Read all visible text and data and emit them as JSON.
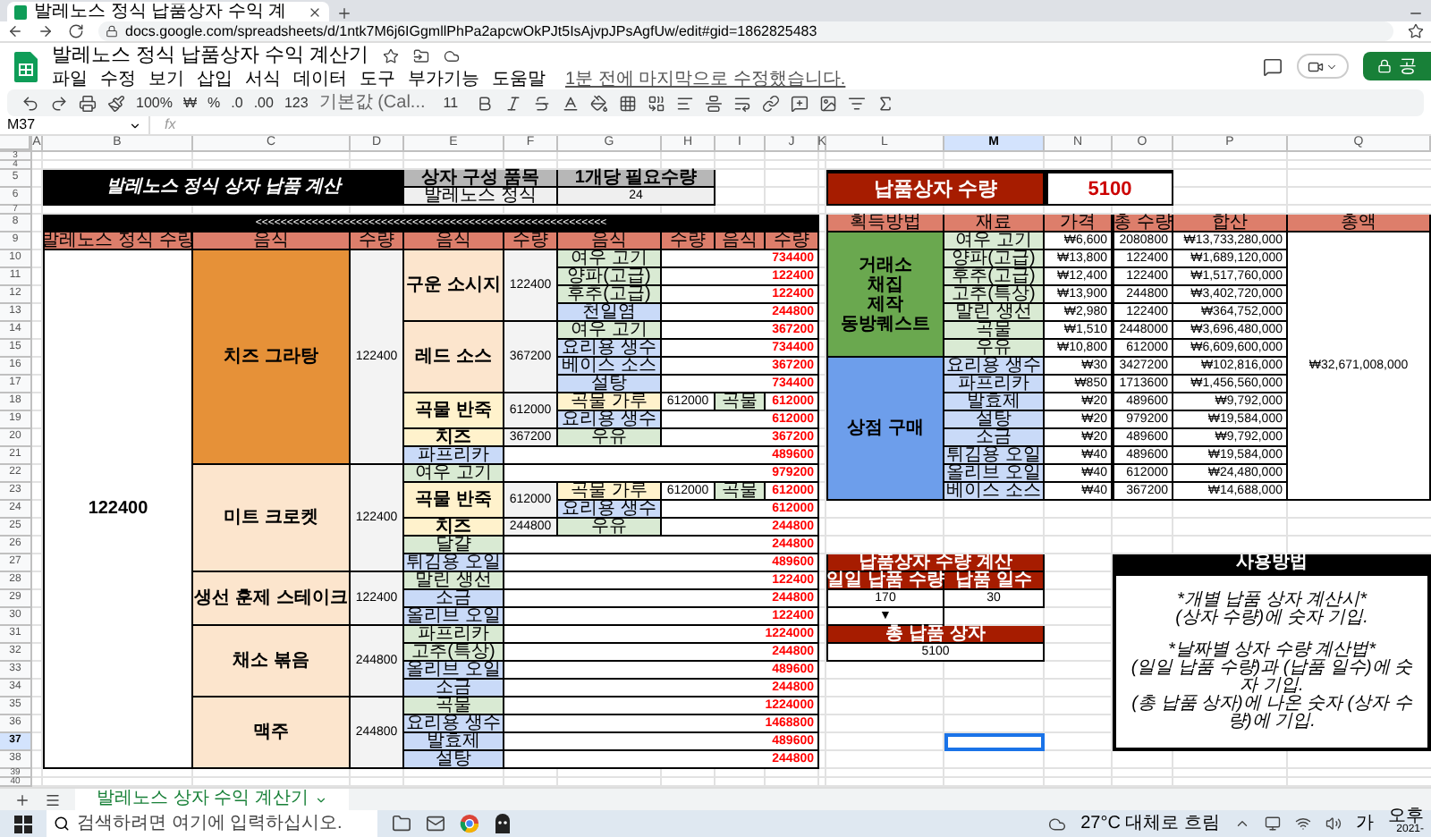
{
  "browser": {
    "tab_title": "발레노스 정식 납품상자 수익 계",
    "url": "docs.google.com/spreadsheets/d/1ntk7M6j6IGgmllPhPa2apcwOkPJt5IsAjvpJPsAgfUw/edit#gid=1862825483"
  },
  "doc": {
    "title": "발레노스 정식 납품상자 수익 계산기",
    "menu": [
      "파일",
      "수정",
      "보기",
      "삽입",
      "서식",
      "데이터",
      "도구",
      "부가기능",
      "도움말"
    ],
    "last_edit": "1분 전에 마지막으로 수정했습니다.",
    "share_label": "공"
  },
  "toolbar": {
    "zoom": "100%",
    "currency": "₩",
    "percent": "%",
    "decrease_decimal": ".0",
    "increase_decimal": ".00",
    "number_format": "123",
    "font": "기본값 (Cal...",
    "font_size": "11"
  },
  "formula_bar": {
    "name_box": "M37",
    "fx": "fx"
  },
  "columns": [
    {
      "label": "A",
      "selected": false
    },
    {
      "label": "B",
      "selected": false
    },
    {
      "label": "C",
      "selected": false
    },
    {
      "label": "D",
      "selected": false
    },
    {
      "label": "E",
      "selected": false
    },
    {
      "label": "F",
      "selected": false
    },
    {
      "label": "G",
      "selected": false
    },
    {
      "label": "H",
      "selected": false
    },
    {
      "label": "I",
      "selected": false
    },
    {
      "label": "J",
      "selected": false
    },
    {
      "label": "K",
      "selected": false
    },
    {
      "label": "L",
      "selected": false
    },
    {
      "label": "M",
      "selected": true
    },
    {
      "label": "N",
      "selected": false
    },
    {
      "label": "O",
      "selected": false
    },
    {
      "label": "P",
      "selected": false
    },
    {
      "label": "Q",
      "selected": false
    }
  ],
  "rows": [
    {
      "label": "3",
      "selected": false
    },
    {
      "label": "4",
      "selected": false
    },
    {
      "label": "5",
      "selected": false
    },
    {
      "label": "6",
      "selected": false
    },
    {
      "label": "7",
      "selected": false
    },
    {
      "label": "8",
      "selected": false
    },
    {
      "label": "9",
      "selected": false
    },
    {
      "label": "10",
      "selected": false
    },
    {
      "label": "11",
      "selected": false
    },
    {
      "label": "12",
      "selected": false
    },
    {
      "label": "13",
      "selected": false
    },
    {
      "label": "14",
      "selected": false
    },
    {
      "label": "15",
      "selected": false
    },
    {
      "label": "16",
      "selected": false
    },
    {
      "label": "17",
      "selected": false
    },
    {
      "label": "18",
      "selected": false
    },
    {
      "label": "19",
      "selected": false
    },
    {
      "label": "20",
      "selected": false
    },
    {
      "label": "21",
      "selected": false
    },
    {
      "label": "22",
      "selected": false
    },
    {
      "label": "23",
      "selected": false
    },
    {
      "label": "24",
      "selected": false
    },
    {
      "label": "25",
      "selected": false
    },
    {
      "label": "26",
      "selected": false
    },
    {
      "label": "27",
      "selected": false
    },
    {
      "label": "28",
      "selected": false
    },
    {
      "label": "29",
      "selected": false
    },
    {
      "label": "30",
      "selected": false
    },
    {
      "label": "31",
      "selected": false
    },
    {
      "label": "32",
      "selected": false
    },
    {
      "label": "33",
      "selected": false
    },
    {
      "label": "34",
      "selected": false
    },
    {
      "label": "35",
      "selected": false
    },
    {
      "label": "36",
      "selected": false
    },
    {
      "label": "37",
      "selected": true
    },
    {
      "label": "38",
      "selected": false
    },
    {
      "label": "39",
      "selected": false
    },
    {
      "label": "40",
      "selected": false
    }
  ],
  "summary": {
    "title": "발레노스 정식 상자 납품 계산",
    "component_header": "상자 구성 품목",
    "component": "발레노스 정식",
    "per_box_header": "1개당 필요수량",
    "per_box": "24"
  },
  "box_count": {
    "label": "납품상자 수량",
    "value": "5100"
  },
  "breakdown": {
    "banner": "<<<<<<<<<<<<<<<<<<<<<<<<<<<<<<<<<<<<<<<<<<<<<<<<<<<<<<<<",
    "headers": [
      "발레노스 정식 수량",
      "음식",
      "수량",
      "음식",
      "수량",
      "음식",
      "수량",
      "음식",
      "수량"
    ],
    "total": "122400",
    "dishes": [
      {
        "name": "치즈 그라탕",
        "qty": "122400",
        "color": "#e69138",
        "components": [
          {
            "kind": "recipe",
            "name": "구운 소시지",
            "color": "#fce5cd",
            "qty": "122400",
            "parts": [
              {
                "kind": "material",
                "name": "여우 고기",
                "color": "#d9ead3",
                "total": "734400"
              },
              {
                "kind": "material",
                "name": "양파(고급)",
                "color": "#d9ead3",
                "total": "122400"
              },
              {
                "kind": "material",
                "name": "후추(고급)",
                "color": "#d9ead3",
                "total": "122400"
              },
              {
                "kind": "material",
                "name": "천일염",
                "color": "#c9daf8",
                "total": "244800"
              }
            ]
          },
          {
            "kind": "recipe",
            "name": "레드 소스",
            "color": "#fce5cd",
            "qty": "367200",
            "parts": [
              {
                "kind": "material",
                "name": "여우 고기",
                "color": "#d9ead3",
                "total": "367200"
              },
              {
                "kind": "material",
                "name": "요리용 생수",
                "color": "#c9daf8",
                "total": "734400"
              },
              {
                "kind": "material",
                "name": "베이스 소스",
                "color": "#c9daf8",
                "total": "367200"
              },
              {
                "kind": "material",
                "name": "설탕",
                "color": "#c9daf8",
                "total": "734400"
              }
            ]
          },
          {
            "kind": "recipe",
            "name": "곡물 반죽",
            "color": "#fff2cc",
            "qty": "612000",
            "parts": [
              {
                "kind": "recipe",
                "name": "곡물 가루",
                "color": "#fff2cc",
                "qty": "612000",
                "sub": {
                  "name": "곡물",
                  "color": "#d9ead3"
                },
                "total": "612000"
              },
              {
                "kind": "material",
                "name": "요리용 생수",
                "color": "#c9daf8",
                "total": "612000"
              }
            ]
          },
          {
            "kind": "recipe",
            "name": "치즈",
            "color": "#fff2cc",
            "qty": "367200",
            "parts": [
              {
                "kind": "material",
                "name": "우유",
                "color": "#d9ead3",
                "total": "367200"
              }
            ]
          },
          {
            "kind": "material",
            "name": "파프리카",
            "color": "#c9daf8",
            "total": "489600"
          }
        ]
      },
      {
        "name": "미트 크로켓",
        "qty": "122400",
        "color": "#fce5cd",
        "components": [
          {
            "kind": "material",
            "name": "여우 고기",
            "color": "#d9ead3",
            "total": "979200"
          },
          {
            "kind": "recipe",
            "name": "곡물 반죽",
            "color": "#fff2cc",
            "qty": "612000",
            "parts": [
              {
                "kind": "recipe",
                "name": "곡물 가루",
                "color": "#fff2cc",
                "qty": "612000",
                "sub": {
                  "name": "곡물",
                  "color": "#d9ead3"
                },
                "total": "612000"
              },
              {
                "kind": "material",
                "name": "요리용 생수",
                "color": "#c9daf8",
                "total": "612000"
              }
            ]
          },
          {
            "kind": "recipe",
            "name": "치즈",
            "color": "#fff2cc",
            "qty": "244800",
            "parts": [
              {
                "kind": "material",
                "name": "우유",
                "color": "#d9ead3",
                "total": "244800"
              }
            ]
          },
          {
            "kind": "material",
            "name": "달걀",
            "color": "#d9ead3",
            "total": "244800"
          },
          {
            "kind": "material",
            "name": "튀김용 오일",
            "color": "#c9daf8",
            "total": "489600"
          }
        ]
      },
      {
        "name": "생선 훈제 스테이크",
        "qty": "122400",
        "color": "#fce5cd",
        "components": [
          {
            "kind": "material",
            "name": "말린 생선",
            "color": "#d9ead3",
            "total": "122400"
          },
          {
            "kind": "material",
            "name": "소금",
            "color": "#c9daf8",
            "total": "244800"
          },
          {
            "kind": "material",
            "name": "올리브 오일",
            "color": "#c9daf8",
            "total": "122400"
          }
        ]
      },
      {
        "name": "채소 볶음",
        "qty": "244800",
        "color": "#fce5cd",
        "components": [
          {
            "kind": "material",
            "name": "파프리카",
            "color": "#d9ead3",
            "total": "1224000"
          },
          {
            "kind": "material",
            "name": "고추(특상)",
            "color": "#d9ead3",
            "total": "244800"
          },
          {
            "kind": "material",
            "name": "올리브 오일",
            "color": "#c9daf8",
            "total": "489600"
          },
          {
            "kind": "material",
            "name": "소금",
            "color": "#c9daf8",
            "total": "244800"
          }
        ]
      },
      {
        "name": "맥주",
        "qty": "244800",
        "color": "#fce5cd",
        "components": [
          {
            "kind": "material",
            "name": "곡물",
            "color": "#d9ead3",
            "total": "1224000"
          },
          {
            "kind": "material",
            "name": "요리용 생수",
            "color": "#c9daf8",
            "total": "1468800"
          },
          {
            "kind": "material",
            "name": "발효제",
            "color": "#c9daf8",
            "total": "489600"
          },
          {
            "kind": "material",
            "name": "설탕",
            "color": "#c9daf8",
            "total": "244800"
          }
        ]
      }
    ]
  },
  "materials": {
    "headers": [
      "획득방법",
      "재료",
      "가격",
      "총 수량",
      "합산",
      "총액"
    ],
    "grand_total": "₩32,671,008,000",
    "groups": [
      {
        "lines": [
          "거래소",
          "채집",
          "제작",
          "동방퀘스트"
        ],
        "color": "#6aa84f",
        "items": [
          {
            "name": "여우 고기",
            "color": "#d9ead3",
            "price": "₩6,600",
            "qty": "2080800",
            "sum": "₩13,733,280,000"
          },
          {
            "name": "양파(고급)",
            "color": "#d9ead3",
            "price": "₩13,800",
            "qty": "122400",
            "sum": "₩1,689,120,000"
          },
          {
            "name": "후추(고급)",
            "color": "#d9ead3",
            "price": "₩12,400",
            "qty": "122400",
            "sum": "₩1,517,760,000"
          },
          {
            "name": "고추(특상)",
            "color": "#d9ead3",
            "price": "₩13,900",
            "qty": "244800",
            "sum": "₩3,402,720,000"
          },
          {
            "name": "말린 생선",
            "color": "#d9ead3",
            "price": "₩2,980",
            "qty": "122400",
            "sum": "₩364,752,000"
          },
          {
            "name": "곡물",
            "color": "#d9ead3",
            "price": "₩1,510",
            "qty": "2448000",
            "sum": "₩3,696,480,000"
          },
          {
            "name": "우유",
            "color": "#d9ead3",
            "price": "₩10,800",
            "qty": "612000",
            "sum": "₩6,609,600,000"
          }
        ]
      },
      {
        "lines": [
          "상점 구매"
        ],
        "color": "#6d9eeb",
        "items": [
          {
            "name": "요리용 생수",
            "color": "#c9daf8",
            "price": "₩30",
            "qty": "3427200",
            "sum": "₩102,816,000"
          },
          {
            "name": "파프리카",
            "color": "#c9daf8",
            "price": "₩850",
            "qty": "1713600",
            "sum": "₩1,456,560,000"
          },
          {
            "name": "발효제",
            "color": "#c9daf8",
            "price": "₩20",
            "qty": "489600",
            "sum": "₩9,792,000"
          },
          {
            "name": "설탕",
            "color": "#c9daf8",
            "price": "₩20",
            "qty": "979200",
            "sum": "₩19,584,000"
          },
          {
            "name": "소금",
            "color": "#c9daf8",
            "price": "₩20",
            "qty": "489600",
            "sum": "₩9,792,000"
          },
          {
            "name": "튀김용 오일",
            "color": "#c9daf8",
            "price": "₩40",
            "qty": "489600",
            "sum": "₩19,584,000"
          },
          {
            "name": "올리브 오일",
            "color": "#c9daf8",
            "price": "₩40",
            "qty": "612000",
            "sum": "₩24,480,000"
          },
          {
            "name": "베이스 소스",
            "color": "#c9daf8",
            "price": "₩40",
            "qty": "367200",
            "sum": "₩14,688,000"
          }
        ]
      }
    ]
  },
  "calculator": {
    "title": "납품상자 수량 계산",
    "headers": [
      "일일 납품 수량",
      "납품 일수"
    ],
    "values": [
      "170",
      "30"
    ],
    "arrow": "▼",
    "total_header": "총 납품 상자",
    "total": "5100"
  },
  "help": {
    "title": "사용방법",
    "paragraphs": [
      [
        "*개별 납품 상자 계산시*",
        "(상자 수량)에 숫자 기입."
      ],
      [
        "*날짜별 상자 수량 계산법*",
        "(일일 납품 수량)과 (납품 일수)에 숫자 기입.",
        "(총 납품 상자)에 나온 숫자 (상자 수량)에 기입."
      ]
    ]
  },
  "sheet_tab": {
    "label": "발레노스 상자 수익 계산기",
    "selected": true
  },
  "taskbar": {
    "search_placeholder": "검색하려면 여기에 입력하십시오.",
    "weather": "27°C 대체로 흐림",
    "ime": "가",
    "time": "오후",
    "date": "2021-"
  }
}
